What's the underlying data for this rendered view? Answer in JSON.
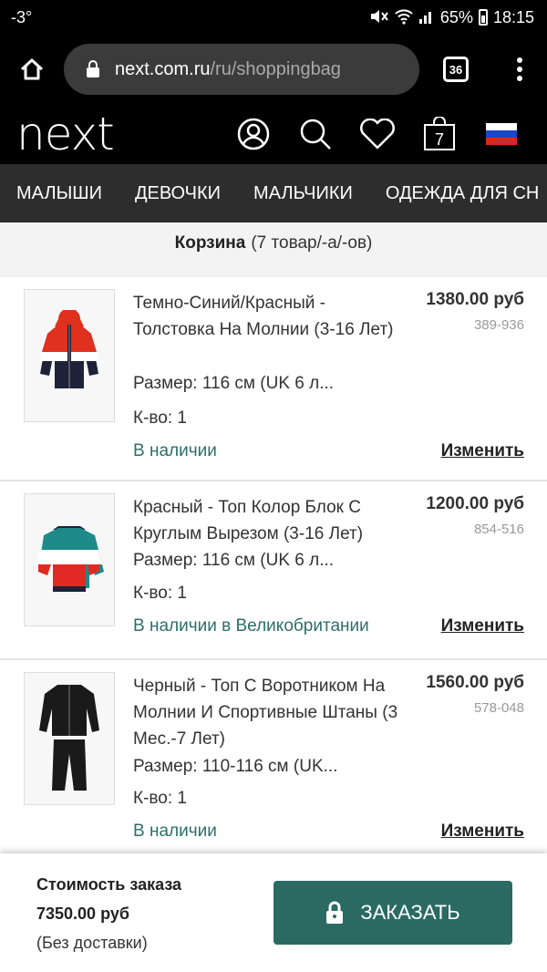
{
  "status_bar": {
    "temp": "-3°",
    "battery": "65%",
    "time": "18:15"
  },
  "browser": {
    "host": "next.com.ru",
    "path": "/ru/shoppingbag",
    "tab_count": "36"
  },
  "site": {
    "logo": "next",
    "bag_count": "7"
  },
  "categories": [
    "МАЛЫШИ",
    "ДЕВОЧКИ",
    "МАЛЬЧИКИ",
    "ОДЕЖДА ДЛЯ СН"
  ],
  "bag": {
    "title": "Корзина",
    "count_text": "(7 товар/-а/-ов)"
  },
  "items": [
    {
      "title": "Темно-Синий/Красный - Толстовка На Молнии (3-16 Лет)",
      "price": "1380.00 руб",
      "code": "389-936",
      "size": "Размер: 116 см (UK 6 л...",
      "qty": "К-во: 1",
      "stock": "В наличии",
      "edit": "Изменить"
    },
    {
      "title": "Красный - Топ Колор Блок С Круглым Вырезом (3-16 Лет)",
      "price": "1200.00 руб",
      "code": "854-516",
      "size": "Размер: 116 см (UK 6 л...",
      "qty": "К-во: 1",
      "stock": "В наличии в Великобритании",
      "edit": "Изменить"
    },
    {
      "title": "Черный - Топ С Воротником На Молнии И Спортивные Штаны (3 Мес.-7 Лет)",
      "price": "1560.00 руб",
      "code": "578-048",
      "size": "Размер: 110-116 см (UK...",
      "qty": "К-во: 1",
      "stock": "В наличии",
      "edit": "Изменить"
    }
  ],
  "summary": {
    "label": "Стоимость заказа",
    "amount": "7350.00 руб",
    "note": "(Без доставки)"
  },
  "checkout": {
    "label": "ЗАКАЗАТЬ"
  },
  "colors": {
    "accent": "#2a6a63",
    "stock_green": "#2d6e6a",
    "nav_bg": "#2d2d2d"
  },
  "icons": [
    "home-icon",
    "lock-icon",
    "tabs-icon",
    "more-icon",
    "account-icon",
    "search-icon",
    "heart-icon",
    "bag-icon",
    "russia-flag-icon",
    "padlock-icon"
  ]
}
